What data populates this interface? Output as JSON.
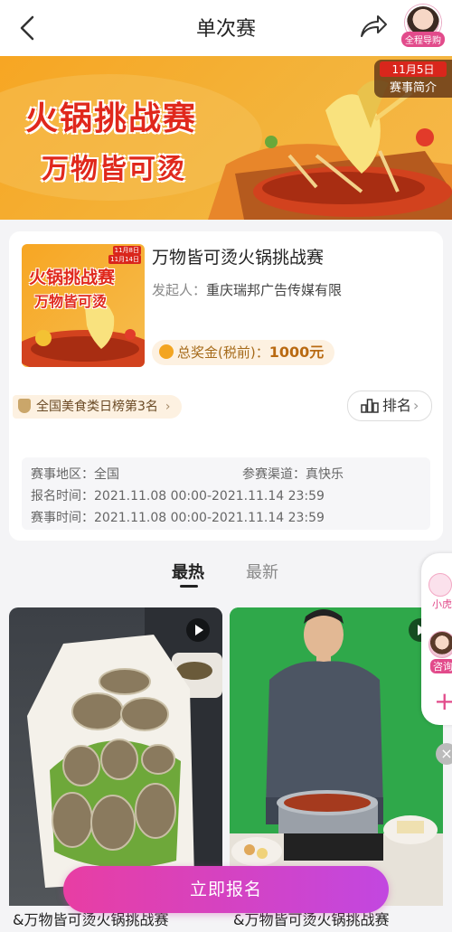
{
  "header": {
    "title": "单次赛",
    "guide_label": "全程导购"
  },
  "banner": {
    "title_line1": "火锅挑战赛",
    "title_line2": "万物皆可烫",
    "date_tag": "11月5日",
    "intro_tag": "赛事简介"
  },
  "card": {
    "cover_line1": "火锅挑战赛",
    "cover_line2": "万物皆可烫",
    "cover_date1": "11月8日",
    "cover_date2": "11月14日",
    "name": "万物皆可烫火锅挑战赛",
    "organizer_label": "发起人：",
    "organizer": "重庆瑞邦广告传媒有限",
    "prize_label": "总奖金(税前)：",
    "prize_amount": "1000元",
    "rank_badge": "全国美食类日榜第3名",
    "rank_button": "排名",
    "region_label": "赛事地区：",
    "region": "全国",
    "channel_label": "参赛渠道：",
    "channel": "真快乐",
    "signup_time_label": "报名时间：",
    "signup_time": "2021.11.08 00:00-2021.11.14 23:59",
    "event_time_label": "赛事时间：",
    "event_time": "2021.11.08 00:00-2021.11.14 23:59"
  },
  "tabs": [
    {
      "label": "最热",
      "active": true
    },
    {
      "label": "最新",
      "active": false
    }
  ],
  "side": {
    "item1": "小虎",
    "item2": "咨询"
  },
  "videos": [
    {
      "title": "&万物皆可烫火锅挑战赛"
    },
    {
      "title": "&万物皆可烫火锅挑战赛"
    }
  ],
  "signup_button": "立即报名",
  "colors": {
    "accent": "#e24b8b",
    "banner_orange": "#f7a623",
    "button_gradient_start": "#e83ea3",
    "button_gradient_end": "#c247e0"
  }
}
